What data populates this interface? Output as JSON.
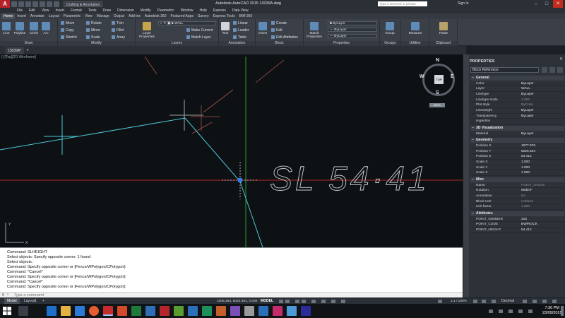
{
  "titlebar": {
    "app_letter": "A",
    "workspace": "Drafting & Annotation",
    "title": "Autodesk AutoCAD 2015    13039A.dwg",
    "search_placeholder": "Type a keyword or phrase",
    "signin": "Sign In",
    "min": "–",
    "max": "□",
    "close": "✕"
  },
  "menubar": [
    "File",
    "Edit",
    "View",
    "Insert",
    "Format",
    "Tools",
    "Draw",
    "Dimension",
    "Modify",
    "Parametric",
    "Window",
    "Help",
    "Express",
    "Data View"
  ],
  "ribbon_tabs": [
    {
      "label": "Home",
      "active": true
    },
    {
      "label": "Insert"
    },
    {
      "label": "Annotate"
    },
    {
      "label": "Layout"
    },
    {
      "label": "Parametric"
    },
    {
      "label": "View"
    },
    {
      "label": "Manage"
    },
    {
      "label": "Output"
    },
    {
      "label": "Add-ins"
    },
    {
      "label": "Autodesk 360"
    },
    {
      "label": "Featured Apps"
    },
    {
      "label": "Survey"
    },
    {
      "label": "Express Tools"
    },
    {
      "label": "BIM 360"
    }
  ],
  "ribbon": {
    "draw": {
      "title": "Draw",
      "line": "Line",
      "polyline": "Polyline",
      "circle": "Circle",
      "arc": "Arc"
    },
    "modify": {
      "title": "Modify",
      "move": "Move",
      "rotate": "Rotate",
      "trim": "Trim",
      "copy": "Copy",
      "mirror": "Mirror",
      "fillet": "Fillet",
      "stretch": "Stretch",
      "scale": "Scale",
      "array": "Array"
    },
    "layers": {
      "title": "Layers",
      "properties": "Layer Properties",
      "current_layer": "WALL",
      "make_current": "Make Current",
      "match_layer": "Match Layer"
    },
    "annotation": {
      "title": "Annotation",
      "text": "Text",
      "linear": "Linear",
      "leader": "Leader",
      "table": "Table"
    },
    "block": {
      "title": "Block",
      "insert": "Insert",
      "create": "Create",
      "edit": "Edit",
      "edit_attributes": "Edit Attributes"
    },
    "properties": {
      "title": "Properties",
      "match": "Match Properties",
      "bylayer1": "ByLayer",
      "bylayer2": "ByLayer",
      "bylayer3": "ByLayer"
    },
    "groups": {
      "title": "Groups",
      "group": "Group"
    },
    "utilities": {
      "title": "Utilities",
      "measure": "Measure"
    },
    "clipboard": {
      "title": "Clipboard",
      "paste": "Paste"
    }
  },
  "file_tab": "13039A*",
  "drawing": {
    "text_label": "SL 54·41",
    "viewcube": {
      "top": "TOP",
      "n": "N",
      "s": "S",
      "e": "E",
      "w": "W",
      "wcs": "WCS"
    }
  },
  "command_history": [
    "Command: SLHEIGHT",
    "Select objects: Specify opposite corner: 1 found",
    "Select objects:",
    "Command: Specify opposite corner or [Fence/WPolygon/CPolygon]:",
    "Command: *Cancel*",
    "Command: Specify opposite corner or [Fence/WPolygon/CPolygon]:",
    "Command: *Cancel*",
    "Command: Specify opposite corner or [Fence/WPolygon/CPolygon]:"
  ],
  "command_prompt_placeholder": "Type a command",
  "statusbar": {
    "tabs": [
      "Model",
      "Layout1"
    ],
    "coords": "1005.363, 5020.491, 0.000",
    "model": "MODEL",
    "scale": "1:1 / 100%",
    "units": "Decimal"
  },
  "properties": {
    "title": "PROPERTIES",
    "object_type": "Block Reference",
    "general_title": "General",
    "general": [
      {
        "k": "Color",
        "v": "ByLayer"
      },
      {
        "k": "Layer",
        "v": "WALL"
      },
      {
        "k": "Linetype",
        "v": "ByLayer"
      },
      {
        "k": "Linetype scale",
        "v": "1.000",
        "dim": true
      },
      {
        "k": "Plot style",
        "v": "ByColor",
        "dim": true
      },
      {
        "k": "Lineweight",
        "v": "ByLayer"
      },
      {
        "k": "Transparency",
        "v": "ByLayer"
      },
      {
        "k": "Hyperlink",
        "v": ""
      }
    ],
    "viz_title": "3D Visualization",
    "viz": [
      {
        "k": "Material",
        "v": "ByLayer"
      }
    ],
    "geom_title": "Geometry",
    "geom": [
      {
        "k": "Position X",
        "v": "1077.976"
      },
      {
        "k": "Position Y",
        "v": "5020.534"
      },
      {
        "k": "Position Z",
        "v": "54.412"
      },
      {
        "k": "Scale X",
        "v": "1.000"
      },
      {
        "k": "Scale Y",
        "v": "1.000"
      },
      {
        "k": "Scale Z",
        "v": "1.000"
      }
    ],
    "misc_title": "Misc",
    "misc": [
      {
        "k": "Name",
        "v": "POINT_LNCSS",
        "dim": true
      },
      {
        "k": "Rotation",
        "v": "90d0'0\""
      },
      {
        "k": "Annotative",
        "v": "No",
        "dim": true
      },
      {
        "k": "Block Unit",
        "v": "Unitless",
        "dim": true
      },
      {
        "k": "Unit factor",
        "v": "1.000",
        "dim": true
      }
    ],
    "attr_title": "Attributes",
    "attr": [
      {
        "k": "POINT_NUMBER",
        "v": "315"
      },
      {
        "k": "POINT_CODE",
        "v": "BW/ROCK"
      },
      {
        "k": "POINT_HEIGHT",
        "v": "54.412"
      }
    ]
  },
  "taskbar": {
    "time": "7:30 PM",
    "date": "23/09/2015"
  }
}
